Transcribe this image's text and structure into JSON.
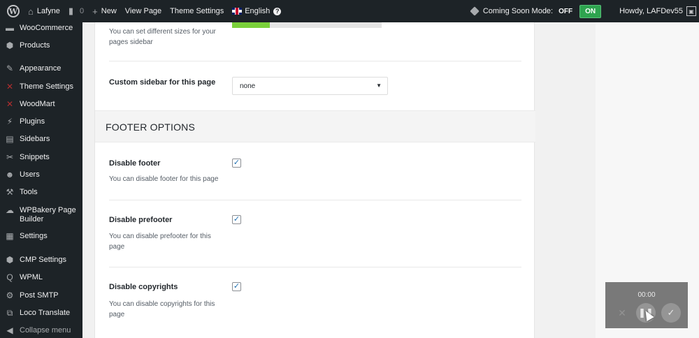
{
  "adminbar": {
    "site_name": "Lafyne",
    "comments_count": "0",
    "new_label": "New",
    "view_page_label": "View Page",
    "theme_settings_label": "Theme Settings",
    "language_label": "English",
    "coming_soon_label": "Coming Soon Mode:",
    "off_label": "OFF",
    "on_label": "ON",
    "howdy_label": "Howdy, LAFDev55"
  },
  "sidebar": {
    "items": [
      {
        "label": "WooCommerce",
        "icon": "woocommerce-icon"
      },
      {
        "label": "Products",
        "icon": "products-icon"
      },
      {
        "label": "Appearance",
        "icon": "appearance-icon"
      },
      {
        "label": "Theme Settings",
        "icon": "theme-settings-icon"
      },
      {
        "label": "WoodMart",
        "icon": "woodmart-icon"
      },
      {
        "label": "Plugins",
        "icon": "plugins-icon"
      },
      {
        "label": "Sidebars",
        "icon": "sidebars-icon"
      },
      {
        "label": "Snippets",
        "icon": "snippets-icon"
      },
      {
        "label": "Users",
        "icon": "users-icon"
      },
      {
        "label": "Tools",
        "icon": "tools-icon"
      },
      {
        "label": "WPBakery Page Builder",
        "icon": "wpbakery-icon"
      },
      {
        "label": "Settings",
        "icon": "settings-icon"
      },
      {
        "label": "CMP Settings",
        "icon": "cmp-settings-icon"
      },
      {
        "label": "WPML",
        "icon": "wpml-icon"
      },
      {
        "label": "Post SMTP",
        "icon": "post-smtp-icon"
      },
      {
        "label": "Loco Translate",
        "icon": "loco-translate-icon"
      },
      {
        "label": "Collapse menu",
        "icon": "collapse-icon"
      }
    ]
  },
  "options": {
    "sidebar_size_desc": "You can set different sizes for your pages sidebar",
    "sidebar_size_progress": 0.25,
    "custom_sidebar_label": "Custom sidebar for this page",
    "custom_sidebar_value": "none",
    "footer_section_title": "FOOTER OPTIONS",
    "disable_footer_label": "Disable footer",
    "disable_footer_desc": "You can disable footer for this page",
    "disable_prefooter_label": "Disable prefooter",
    "disable_prefooter_desc": "You can disable prefooter for this page",
    "disable_copyrights_label": "Disable copyrights",
    "disable_copyrights_desc": "You can disable copyrights for this page"
  },
  "recorder": {
    "time": "00:00"
  },
  "colors": {
    "adminbar_bg": "#1d2327",
    "on_badge": "#2ea44f",
    "checkbox_check": "#2271b1",
    "progress_fill": "#7ad03a"
  }
}
